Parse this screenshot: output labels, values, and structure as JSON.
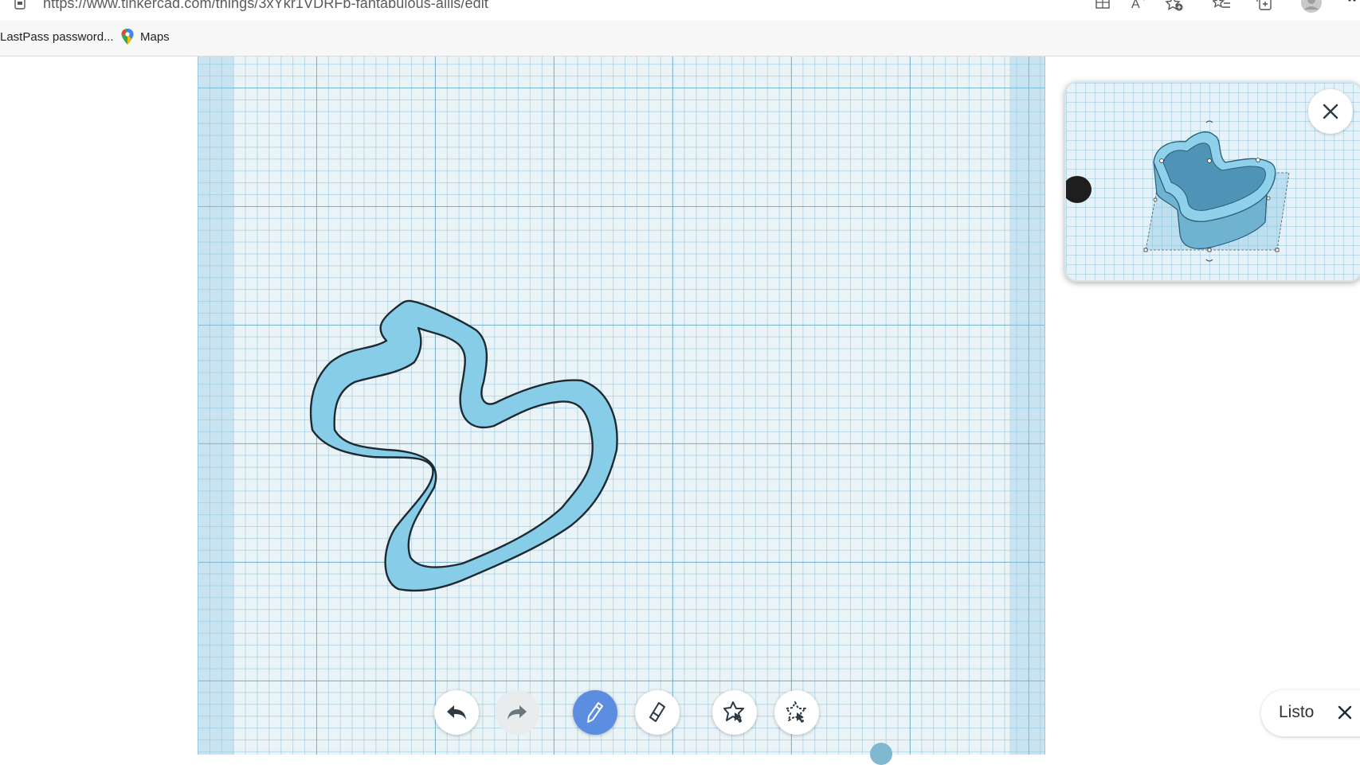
{
  "browser": {
    "url": "https://www.tinkercad.com/things/3xYkr1VDRFb-fantabulous-allis/edit",
    "bookmarks": [
      {
        "label": "LastPass password..."
      },
      {
        "label": "Maps"
      }
    ]
  },
  "toolbar": {
    "tools": [
      "undo",
      "redo",
      "pencil",
      "eraser",
      "shape-select",
      "shape-deselect"
    ],
    "active_tool": "pencil"
  },
  "preview": {
    "close_icon": "close-icon"
  },
  "done": {
    "label": "Listo"
  },
  "colors": {
    "shape_fill": "#87cde8",
    "shape_stroke": "#1d2a33",
    "grid_bg": "#eaf3f6",
    "accent": "#5b8ee0"
  }
}
